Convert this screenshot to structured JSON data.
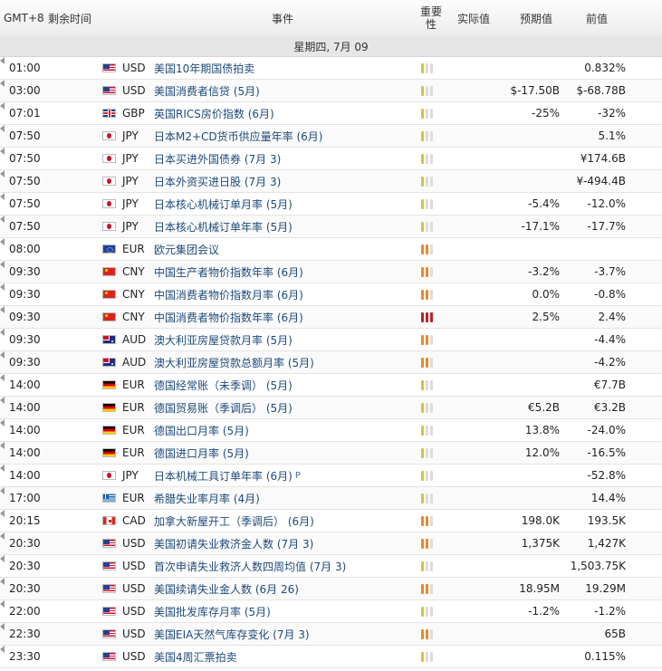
{
  "header": {
    "gmt": "GMT+8",
    "remaining": "剩余时间",
    "event": "事件",
    "importance": "重要性",
    "actual": "实际值",
    "forecast": "预期值",
    "previous": "前值"
  },
  "date_label": "星期四, 7月 09",
  "importance_colors": {
    "low": "#d8c23a",
    "medium": "#e6892e",
    "high": "#b8242a",
    "off": "#dcdcdc"
  },
  "rows": [
    {
      "time": "01:00",
      "flag": "US",
      "currency": "USD",
      "event": "美国10年期国债拍卖",
      "importance": 1,
      "actual": "",
      "forecast": "",
      "previous": "0.832%"
    },
    {
      "time": "03:00",
      "flag": "US",
      "currency": "USD",
      "event": "美国消费者信贷 (5月)",
      "importance": 1,
      "actual": "",
      "forecast": "$-17.50B",
      "previous": "$-68.78B"
    },
    {
      "time": "07:01",
      "flag": "GB",
      "currency": "GBP",
      "event": "英国RICS房价指数 (6月)",
      "importance": 1,
      "actual": "",
      "forecast": "-25%",
      "previous": "-32%"
    },
    {
      "time": "07:50",
      "flag": "JP",
      "currency": "JPY",
      "event": "日本M2+CD货币供应量年率 (6月)",
      "importance": 1,
      "actual": "",
      "forecast": "",
      "previous": "5.1%"
    },
    {
      "time": "07:50",
      "flag": "JP",
      "currency": "JPY",
      "event": "日本买进外国债券 (7月 3)",
      "importance": 1,
      "actual": "",
      "forecast": "",
      "previous": "¥174.6B"
    },
    {
      "time": "07:50",
      "flag": "JP",
      "currency": "JPY",
      "event": "日本外资买进日股 (7月 3)",
      "importance": 1,
      "actual": "",
      "forecast": "",
      "previous": "¥-494.4B"
    },
    {
      "time": "07:50",
      "flag": "JP",
      "currency": "JPY",
      "event": "日本核心机械订单月率 (5月)",
      "importance": 1,
      "actual": "",
      "forecast": "-5.4%",
      "previous": "-12.0%"
    },
    {
      "time": "07:50",
      "flag": "JP",
      "currency": "JPY",
      "event": "日本核心机械订单年率 (5月)",
      "importance": 1,
      "actual": "",
      "forecast": "-17.1%",
      "previous": "-17.7%"
    },
    {
      "time": "08:00",
      "flag": "EU",
      "currency": "EUR",
      "event": "欧元集团会议",
      "importance": 2,
      "actual": "",
      "forecast": "",
      "previous": ""
    },
    {
      "time": "09:30",
      "flag": "CN",
      "currency": "CNY",
      "event": "中国生产者物价指数年率 (6月)",
      "importance": 2,
      "actual": "",
      "forecast": "-3.2%",
      "previous": "-3.7%"
    },
    {
      "time": "09:30",
      "flag": "CN",
      "currency": "CNY",
      "event": "中国消费者物价指数月率 (6月)",
      "importance": 2,
      "actual": "",
      "forecast": "0.0%",
      "previous": "-0.8%"
    },
    {
      "time": "09:30",
      "flag": "CN",
      "currency": "CNY",
      "event": "中国消费者物价指数年率 (6月)",
      "importance": 3,
      "actual": "",
      "forecast": "2.5%",
      "previous": "2.4%"
    },
    {
      "time": "09:30",
      "flag": "AU",
      "currency": "AUD",
      "event": "澳大利亚房屋贷款月率 (5月)",
      "importance": 2,
      "actual": "",
      "forecast": "",
      "previous": "-4.4%"
    },
    {
      "time": "09:30",
      "flag": "AU",
      "currency": "AUD",
      "event": "澳大利亚房屋贷款总额月率 (5月)",
      "importance": 2,
      "actual": "",
      "forecast": "",
      "previous": "-4.2%"
    },
    {
      "time": "14:00",
      "flag": "DE",
      "currency": "EUR",
      "event": "德国经常账（未季调） (5月)",
      "importance": 1,
      "actual": "",
      "forecast": "",
      "previous": "€7.7B"
    },
    {
      "time": "14:00",
      "flag": "DE",
      "currency": "EUR",
      "event": "德国贸易账（季调后） (5月)",
      "importance": 1,
      "actual": "",
      "forecast": "€5.2B",
      "previous": "€3.2B"
    },
    {
      "time": "14:00",
      "flag": "DE",
      "currency": "EUR",
      "event": "德国出口月率 (5月)",
      "importance": 1,
      "actual": "",
      "forecast": "13.8%",
      "previous": "-24.0%"
    },
    {
      "time": "14:00",
      "flag": "DE",
      "currency": "EUR",
      "event": "德国进口月率 (5月)",
      "importance": 1,
      "actual": "",
      "forecast": "12.0%",
      "previous": "-16.5%"
    },
    {
      "time": "14:00",
      "flag": "JP",
      "currency": "JPY",
      "event": "日本机械工具订单年率 (6月)",
      "mark": "P",
      "importance": 1,
      "actual": "",
      "forecast": "",
      "previous": "-52.8%"
    },
    {
      "time": "17:00",
      "flag": "GR",
      "currency": "EUR",
      "event": "希腊失业率月率 (4月)",
      "importance": 1,
      "actual": "",
      "forecast": "",
      "previous": "14.4%"
    },
    {
      "time": "20:15",
      "flag": "CA",
      "currency": "CAD",
      "event": "加拿大新屋开工（季调后） (6月)",
      "importance": 2,
      "actual": "",
      "forecast": "198.0K",
      "previous": "193.5K"
    },
    {
      "time": "20:30",
      "flag": "US",
      "currency": "USD",
      "event": "美国初请失业救济金人数 (7月 3)",
      "importance": 2,
      "actual": "",
      "forecast": "1,375K",
      "previous": "1,427K"
    },
    {
      "time": "20:30",
      "flag": "US",
      "currency": "USD",
      "event": "首次申请失业救济人数四周均值 (7月 3)",
      "importance": 1,
      "actual": "",
      "forecast": "",
      "previous": "1,503.75K"
    },
    {
      "time": "20:30",
      "flag": "US",
      "currency": "USD",
      "event": "美国续请失业金人数 (6月 26)",
      "importance": 2,
      "actual": "",
      "forecast": "18.95M",
      "previous": "19.29M"
    },
    {
      "time": "22:00",
      "flag": "US",
      "currency": "USD",
      "event": "美国批发库存月率 (5月)",
      "importance": 1,
      "actual": "",
      "forecast": "-1.2%",
      "previous": "-1.2%"
    },
    {
      "time": "22:30",
      "flag": "US",
      "currency": "USD",
      "event": "美国EIA天然气库存变化 (7月 3)",
      "importance": 2,
      "actual": "",
      "forecast": "",
      "previous": "65B"
    },
    {
      "time": "23:30",
      "flag": "US",
      "currency": "USD",
      "event": "美国4周汇票拍卖",
      "importance": 1,
      "actual": "",
      "forecast": "",
      "previous": "0.115%"
    }
  ]
}
